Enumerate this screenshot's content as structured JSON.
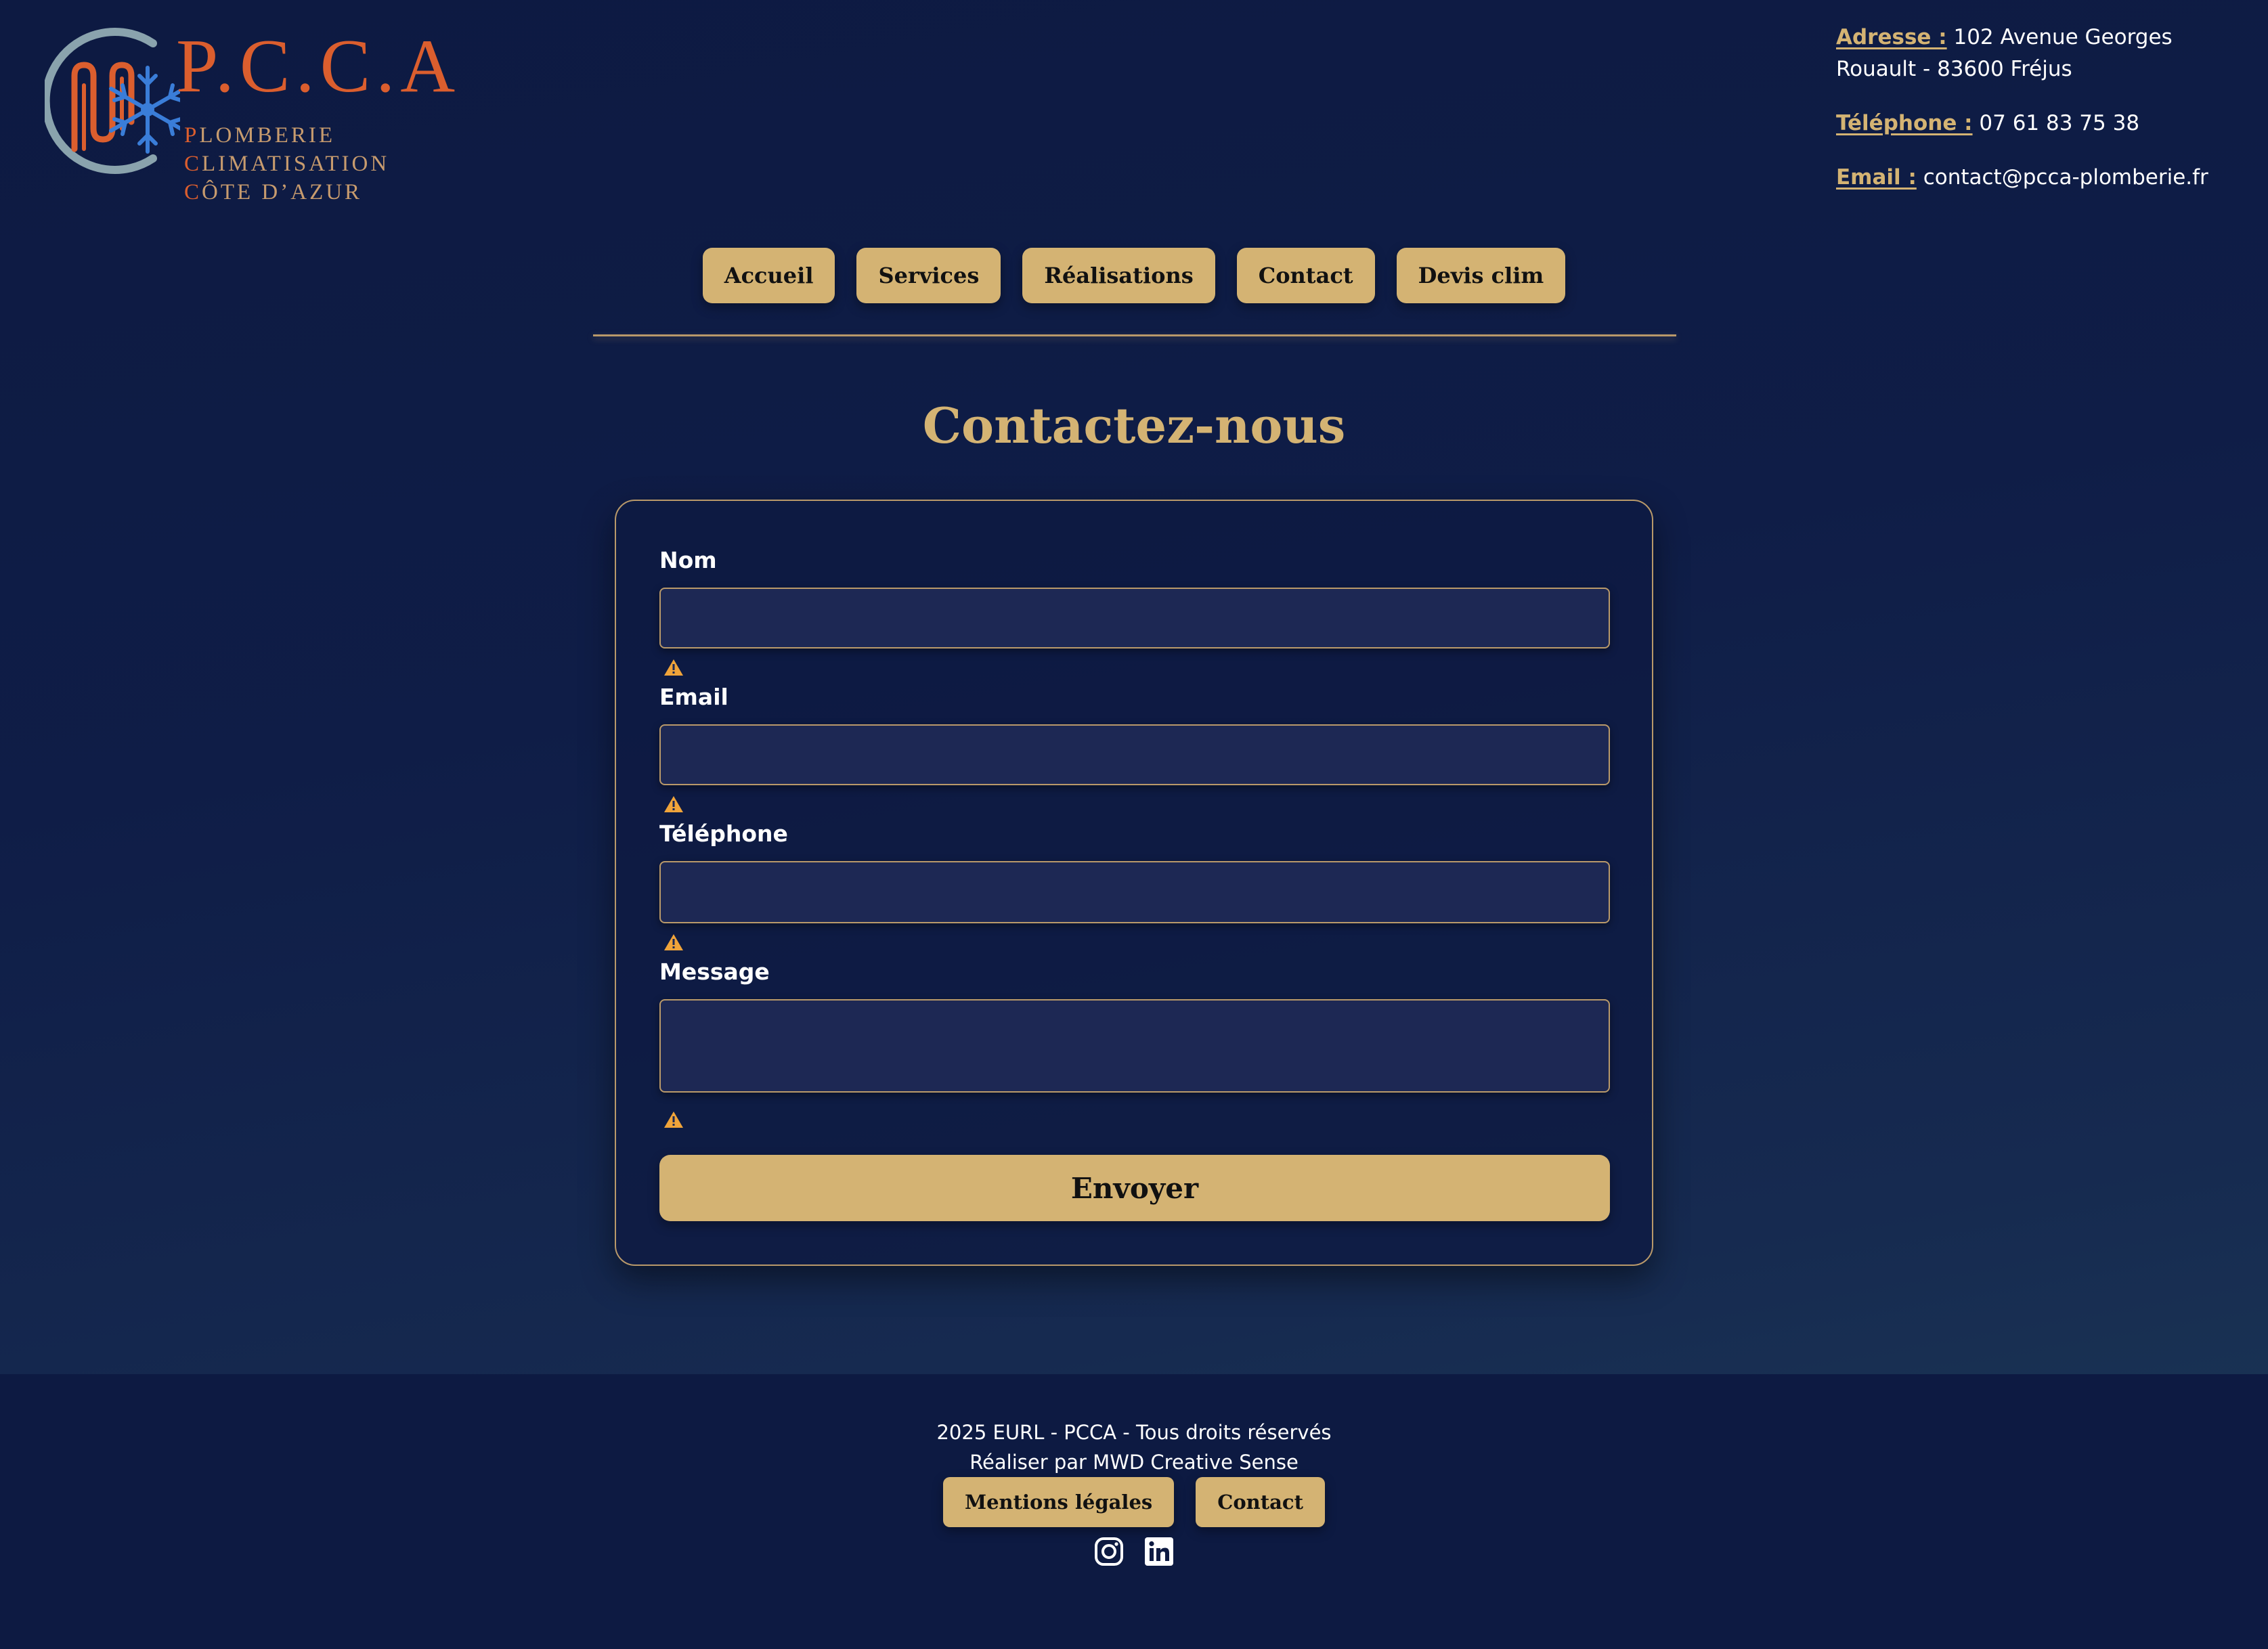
{
  "brand": {
    "title": "P.C.C.A",
    "lines": [
      {
        "cap": "P",
        "rest": "LOMBERIE"
      },
      {
        "cap": "C",
        "rest": "LIMATISATION"
      },
      {
        "cap": "C",
        "rest": "ÔTE D’AZUR"
      }
    ],
    "logo_icon": "pipe-snowflake-logo",
    "colors": {
      "orange": "#db5e2e",
      "blue": "#3a7dd8",
      "ring": "#8aa3ad",
      "sub": "#c79b6e"
    }
  },
  "contact_info": {
    "address_label": "Adresse :",
    "address_value": "102 Avenue Georges Rouault - 83600 Fréjus",
    "phone_label": "Téléphone :",
    "phone_value": "07 61 83 75 38",
    "email_label": "Email :",
    "email_value": "contact@pcca-plomberie.fr"
  },
  "nav": {
    "items": [
      {
        "label": "Accueil"
      },
      {
        "label": "Services"
      },
      {
        "label": "Réalisations"
      },
      {
        "label": "Contact"
      },
      {
        "label": "Devis clim"
      }
    ]
  },
  "page": {
    "title": "Contactez-nous"
  },
  "form": {
    "fields": [
      {
        "label": "Nom",
        "value": ""
      },
      {
        "label": "Email",
        "value": ""
      },
      {
        "label": "Téléphone",
        "value": ""
      },
      {
        "label": "Message",
        "value": ""
      }
    ],
    "warning_icon": "warning-icon",
    "submit_label": "Envoyer"
  },
  "footer": {
    "copyright": "2025 EURL - PCCA - Tous droits réservés",
    "credit": "Réaliser par MWD Creative Sense",
    "links": [
      {
        "label": "Mentions légales"
      },
      {
        "label": "Contact"
      }
    ],
    "social_icons": [
      "instagram-icon",
      "linkedin-icon"
    ]
  },
  "theme": {
    "background": "#0d1a42",
    "gold": "#d4b373",
    "input_bg": "#1d2854",
    "warning": "#f0a43a"
  }
}
